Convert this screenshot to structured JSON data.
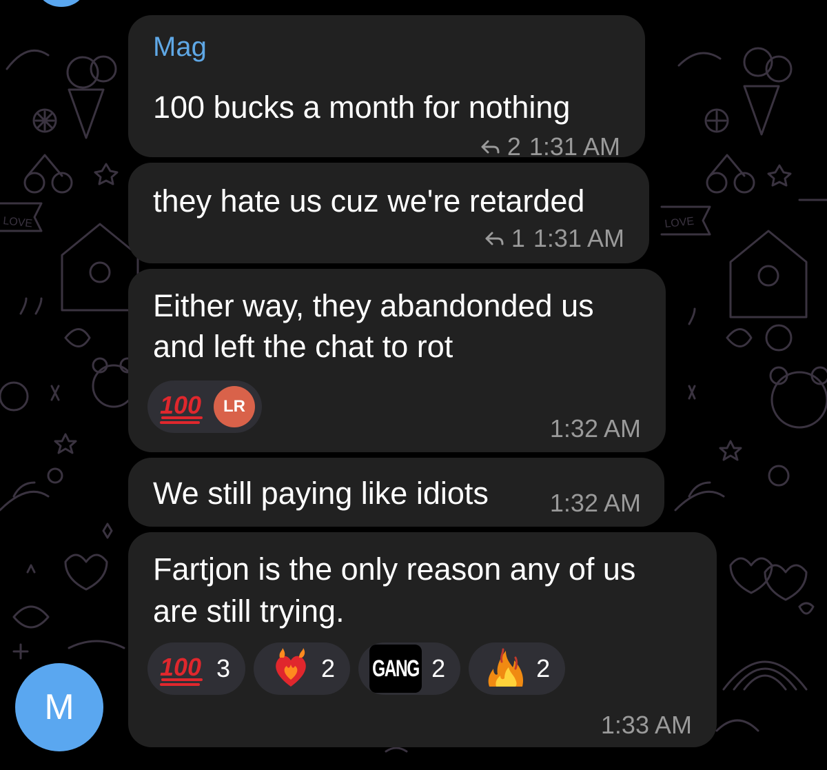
{
  "sender": {
    "name": "Mag",
    "avatar_letter": "M"
  },
  "colors": {
    "background": "#000000",
    "bubble": "#212121",
    "sender_name": "#5fa8e6",
    "avatar": "#5aa7f0",
    "reaction_pill": "#2f2f35",
    "meta_text": "#9a9a9a"
  },
  "wallpaper": {
    "doodle_text": "LOVE"
  },
  "messages": [
    {
      "lines": [
        "100 bucks a month for nothing"
      ],
      "reply_count": "2",
      "time": "1:31 AM"
    },
    {
      "lines": [
        "they hate us cuz we're retarded"
      ],
      "reply_count": "1",
      "time": "1:31 AM"
    },
    {
      "lines": [
        "Either way, they abandonded us",
        "and left the chat to rot"
      ],
      "time": "1:32 AM",
      "reactions": [
        {
          "emoji": "hundred-points",
          "reactor_initials": "LR"
        }
      ]
    },
    {
      "lines": [
        "We still paying like idiots"
      ],
      "time": "1:32 AM"
    },
    {
      "lines": [
        "Fartjon is the only reason any of us",
        "are still trying."
      ],
      "time": "1:33 AM",
      "reactions": [
        {
          "emoji": "hundred-points",
          "count": "3"
        },
        {
          "emoji": "heart-on-fire",
          "count": "2"
        },
        {
          "emoji": "gang-sticker",
          "label": "GANG",
          "count": "2"
        },
        {
          "emoji": "fire",
          "count": "2"
        }
      ]
    }
  ]
}
